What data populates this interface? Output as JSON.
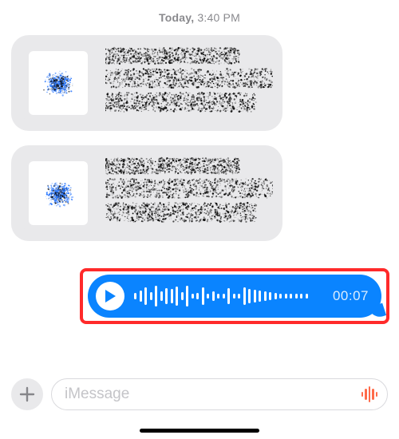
{
  "timestamp": {
    "day": "Today,",
    "time": "3:40 PM"
  },
  "incoming": [
    {
      "id": "msg1",
      "redacted": true
    },
    {
      "id": "msg2",
      "redacted": true
    }
  ],
  "outgoing_audio": {
    "duration_label": "00:07",
    "waveform_heights": [
      8,
      14,
      22,
      10,
      26,
      12,
      20,
      18,
      24,
      10,
      26,
      6,
      8,
      22,
      6,
      12,
      6,
      6,
      20,
      6,
      6,
      22,
      18,
      16,
      14,
      12,
      10,
      8,
      6,
      6,
      6,
      6,
      6,
      6
    ]
  },
  "composer": {
    "placeholder": "iMessage",
    "audio_bars": [
      6,
      14,
      20,
      14,
      6
    ]
  },
  "colors": {
    "outgoing_blue": "#0a84ff",
    "incoming_gray": "#e9e9eb",
    "highlight_red": "#ff2a2a",
    "audio_icon": "#ff6b4a"
  }
}
